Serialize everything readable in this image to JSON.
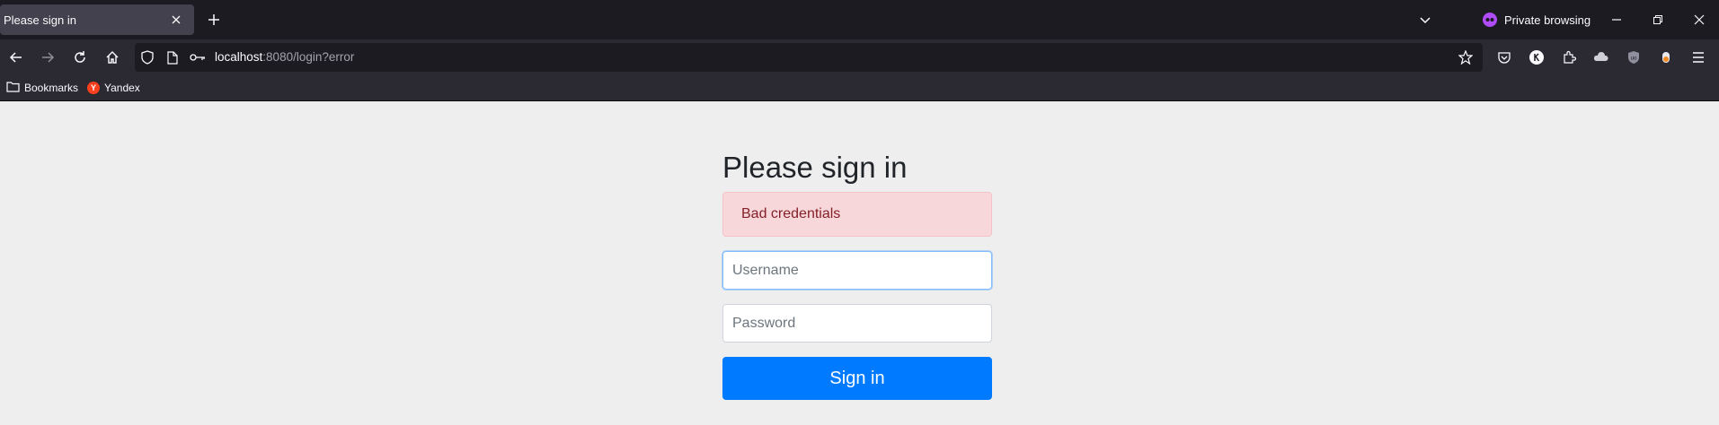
{
  "browser": {
    "tab": {
      "title": "Please sign in"
    },
    "private_label": "Private browsing",
    "url": {
      "host": "localhost",
      "rest": ":8080/login?error"
    },
    "bookmarks": [
      {
        "label": "Bookmarks",
        "icon": "folder-icon"
      },
      {
        "label": "Yandex",
        "icon": "yandex-icon",
        "badge": "Y"
      }
    ]
  },
  "page": {
    "heading": "Please sign in",
    "alert": "Bad credentials",
    "username_placeholder": "Username",
    "password_placeholder": "Password",
    "signin_label": "Sign in"
  },
  "colors": {
    "primary": "#007bff",
    "alert_bg": "#f8d7da",
    "alert_text": "#842029",
    "page_bg": "#eeeeee",
    "private_accent": "#b04cf6"
  }
}
